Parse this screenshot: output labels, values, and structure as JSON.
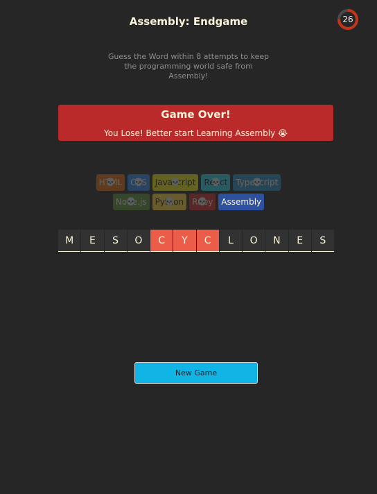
{
  "header": {
    "title": "Assembly: Endgame",
    "subtitle": "Guess the Word within 8 attempts to keep the programming world safe from Assembly!"
  },
  "timer": {
    "value": "26",
    "progress": 0.75,
    "ring_color": "#c2351a"
  },
  "status": {
    "title": "Game Over!",
    "message": "You Lose! Better start Learning Assembly 😭",
    "color": "#ba2a2a"
  },
  "languages": [
    {
      "name": "HTML",
      "bg": "#E2680F",
      "fg": "#F9F4DA",
      "lost": true
    },
    {
      "name": "CSS",
      "bg": "#328AF1",
      "fg": "#F9F4DA",
      "lost": true
    },
    {
      "name": "Javascript",
      "bg": "#F4EB13",
      "fg": "#1E1E1E",
      "lost": true
    },
    {
      "name": "React",
      "bg": "#2ED3E9",
      "fg": "#1E1E1E",
      "lost": true
    },
    {
      "name": "Typescript",
      "bg": "#298EC6",
      "fg": "#F9F4DA",
      "lost": true
    },
    {
      "name": "Node.js",
      "bg": "#599137",
      "fg": "#F9F4DA",
      "lost": true
    },
    {
      "name": "Python",
      "bg": "#FFD742",
      "fg": "#1E1E1E",
      "lost": true
    },
    {
      "name": "Ruby",
      "bg": "#D02B2B",
      "fg": "#F9F4DA",
      "lost": true
    },
    {
      "name": "Assembly",
      "bg": "#2D519F",
      "fg": "#F9F4DA",
      "lost": false
    }
  ],
  "skull_icon": "💀",
  "word": [
    {
      "letter": "M",
      "missed": false
    },
    {
      "letter": "E",
      "missed": false
    },
    {
      "letter": "S",
      "missed": false
    },
    {
      "letter": "O",
      "missed": false
    },
    {
      "letter": "C",
      "missed": true
    },
    {
      "letter": "Y",
      "missed": true
    },
    {
      "letter": "C",
      "missed": true
    },
    {
      "letter": "L",
      "missed": false
    },
    {
      "letter": "O",
      "missed": false
    },
    {
      "letter": "N",
      "missed": false
    },
    {
      "letter": "E",
      "missed": false
    },
    {
      "letter": "S",
      "missed": false
    }
  ],
  "new_game_label": "New Game"
}
